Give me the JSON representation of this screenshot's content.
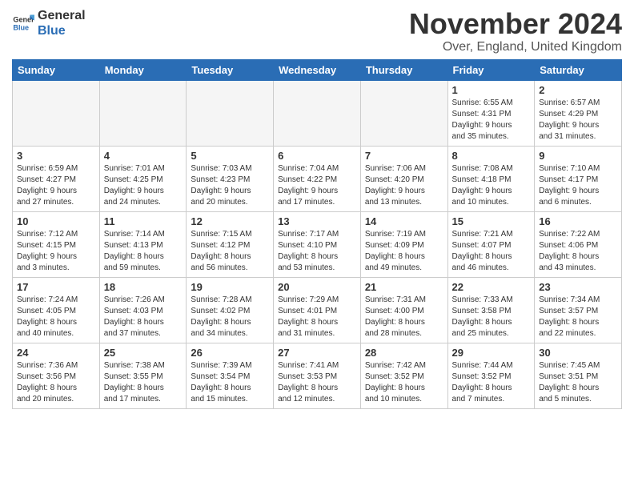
{
  "header": {
    "logo_general": "General",
    "logo_blue": "Blue",
    "month_title": "November 2024",
    "location": "Over, England, United Kingdom"
  },
  "days_of_week": [
    "Sunday",
    "Monday",
    "Tuesday",
    "Wednesday",
    "Thursday",
    "Friday",
    "Saturday"
  ],
  "weeks": [
    [
      {
        "day": "",
        "empty": true
      },
      {
        "day": "",
        "empty": true
      },
      {
        "day": "",
        "empty": true
      },
      {
        "day": "",
        "empty": true
      },
      {
        "day": "",
        "empty": true
      },
      {
        "day": "1",
        "lines": [
          "Sunrise: 6:55 AM",
          "Sunset: 4:31 PM",
          "Daylight: 9 hours",
          "and 35 minutes."
        ]
      },
      {
        "day": "2",
        "lines": [
          "Sunrise: 6:57 AM",
          "Sunset: 4:29 PM",
          "Daylight: 9 hours",
          "and 31 minutes."
        ]
      }
    ],
    [
      {
        "day": "3",
        "lines": [
          "Sunrise: 6:59 AM",
          "Sunset: 4:27 PM",
          "Daylight: 9 hours",
          "and 27 minutes."
        ]
      },
      {
        "day": "4",
        "lines": [
          "Sunrise: 7:01 AM",
          "Sunset: 4:25 PM",
          "Daylight: 9 hours",
          "and 24 minutes."
        ]
      },
      {
        "day": "5",
        "lines": [
          "Sunrise: 7:03 AM",
          "Sunset: 4:23 PM",
          "Daylight: 9 hours",
          "and 20 minutes."
        ]
      },
      {
        "day": "6",
        "lines": [
          "Sunrise: 7:04 AM",
          "Sunset: 4:22 PM",
          "Daylight: 9 hours",
          "and 17 minutes."
        ]
      },
      {
        "day": "7",
        "lines": [
          "Sunrise: 7:06 AM",
          "Sunset: 4:20 PM",
          "Daylight: 9 hours",
          "and 13 minutes."
        ]
      },
      {
        "day": "8",
        "lines": [
          "Sunrise: 7:08 AM",
          "Sunset: 4:18 PM",
          "Daylight: 9 hours",
          "and 10 minutes."
        ]
      },
      {
        "day": "9",
        "lines": [
          "Sunrise: 7:10 AM",
          "Sunset: 4:17 PM",
          "Daylight: 9 hours",
          "and 6 minutes."
        ]
      }
    ],
    [
      {
        "day": "10",
        "lines": [
          "Sunrise: 7:12 AM",
          "Sunset: 4:15 PM",
          "Daylight: 9 hours",
          "and 3 minutes."
        ]
      },
      {
        "day": "11",
        "lines": [
          "Sunrise: 7:14 AM",
          "Sunset: 4:13 PM",
          "Daylight: 8 hours",
          "and 59 minutes."
        ]
      },
      {
        "day": "12",
        "lines": [
          "Sunrise: 7:15 AM",
          "Sunset: 4:12 PM",
          "Daylight: 8 hours",
          "and 56 minutes."
        ]
      },
      {
        "day": "13",
        "lines": [
          "Sunrise: 7:17 AM",
          "Sunset: 4:10 PM",
          "Daylight: 8 hours",
          "and 53 minutes."
        ]
      },
      {
        "day": "14",
        "lines": [
          "Sunrise: 7:19 AM",
          "Sunset: 4:09 PM",
          "Daylight: 8 hours",
          "and 49 minutes."
        ]
      },
      {
        "day": "15",
        "lines": [
          "Sunrise: 7:21 AM",
          "Sunset: 4:07 PM",
          "Daylight: 8 hours",
          "and 46 minutes."
        ]
      },
      {
        "day": "16",
        "lines": [
          "Sunrise: 7:22 AM",
          "Sunset: 4:06 PM",
          "Daylight: 8 hours",
          "and 43 minutes."
        ]
      }
    ],
    [
      {
        "day": "17",
        "lines": [
          "Sunrise: 7:24 AM",
          "Sunset: 4:05 PM",
          "Daylight: 8 hours",
          "and 40 minutes."
        ]
      },
      {
        "day": "18",
        "lines": [
          "Sunrise: 7:26 AM",
          "Sunset: 4:03 PM",
          "Daylight: 8 hours",
          "and 37 minutes."
        ]
      },
      {
        "day": "19",
        "lines": [
          "Sunrise: 7:28 AM",
          "Sunset: 4:02 PM",
          "Daylight: 8 hours",
          "and 34 minutes."
        ]
      },
      {
        "day": "20",
        "lines": [
          "Sunrise: 7:29 AM",
          "Sunset: 4:01 PM",
          "Daylight: 8 hours",
          "and 31 minutes."
        ]
      },
      {
        "day": "21",
        "lines": [
          "Sunrise: 7:31 AM",
          "Sunset: 4:00 PM",
          "Daylight: 8 hours",
          "and 28 minutes."
        ]
      },
      {
        "day": "22",
        "lines": [
          "Sunrise: 7:33 AM",
          "Sunset: 3:58 PM",
          "Daylight: 8 hours",
          "and 25 minutes."
        ]
      },
      {
        "day": "23",
        "lines": [
          "Sunrise: 7:34 AM",
          "Sunset: 3:57 PM",
          "Daylight: 8 hours",
          "and 22 minutes."
        ]
      }
    ],
    [
      {
        "day": "24",
        "lines": [
          "Sunrise: 7:36 AM",
          "Sunset: 3:56 PM",
          "Daylight: 8 hours",
          "and 20 minutes."
        ]
      },
      {
        "day": "25",
        "lines": [
          "Sunrise: 7:38 AM",
          "Sunset: 3:55 PM",
          "Daylight: 8 hours",
          "and 17 minutes."
        ]
      },
      {
        "day": "26",
        "lines": [
          "Sunrise: 7:39 AM",
          "Sunset: 3:54 PM",
          "Daylight: 8 hours",
          "and 15 minutes."
        ]
      },
      {
        "day": "27",
        "lines": [
          "Sunrise: 7:41 AM",
          "Sunset: 3:53 PM",
          "Daylight: 8 hours",
          "and 12 minutes."
        ]
      },
      {
        "day": "28",
        "lines": [
          "Sunrise: 7:42 AM",
          "Sunset: 3:52 PM",
          "Daylight: 8 hours",
          "and 10 minutes."
        ]
      },
      {
        "day": "29",
        "lines": [
          "Sunrise: 7:44 AM",
          "Sunset: 3:52 PM",
          "Daylight: 8 hours",
          "and 7 minutes."
        ]
      },
      {
        "day": "30",
        "lines": [
          "Sunrise: 7:45 AM",
          "Sunset: 3:51 PM",
          "Daylight: 8 hours",
          "and 5 minutes."
        ]
      }
    ]
  ]
}
